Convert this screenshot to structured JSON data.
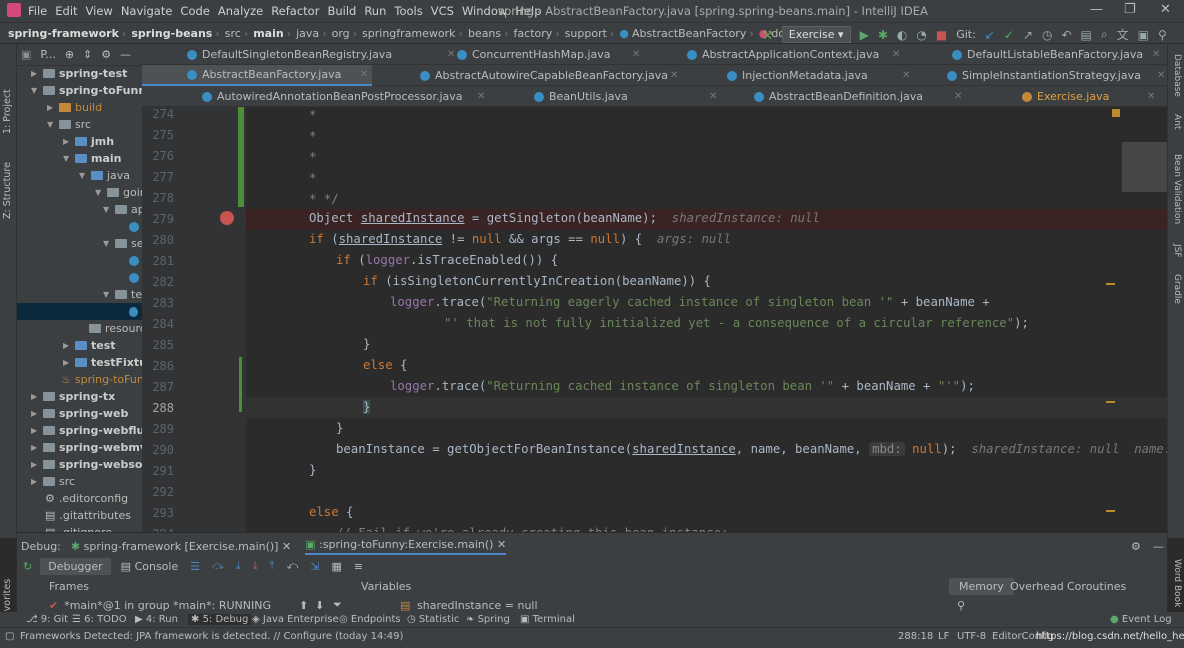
{
  "menu": [
    "File",
    "Edit",
    "View",
    "Navigate",
    "Code",
    "Analyze",
    "Refactor",
    "Build",
    "Run",
    "Tools",
    "VCS",
    "Window",
    "Help"
  ],
  "window_title": "spring - AbstractBeanFactory.java [spring.spring-beans.main] - IntelliJ IDEA",
  "breadcrumbs": [
    "spring-framework",
    "spring-beans",
    "src",
    "main",
    "java",
    "org",
    "springframework",
    "beans",
    "factory",
    "support",
    "AbstractBeanFactory",
    "doGetBean"
  ],
  "run_config": "Exercise",
  "git_label": "Git:",
  "project_panel": {
    "label": "P...",
    "tool_label": "1: Project",
    "structure_label": "Z: Structure"
  },
  "tree": [
    {
      "label": "spring-test",
      "bold": true
    },
    {
      "label": "spring-toFunny",
      "bold": true
    },
    {
      "label": "build",
      "bold": false
    },
    {
      "label": "src",
      "bold": false
    },
    {
      "label": "jmh",
      "bold": true
    },
    {
      "label": "main",
      "bold": true
    },
    {
      "label": "java",
      "bold": false
    },
    {
      "label": "going",
      "bold": false
    },
    {
      "label": "ap",
      "bold": false
    },
    {
      "label": "se",
      "bold": false
    },
    {
      "label": "tes",
      "bold": false
    },
    {
      "label": "resource",
      "bold": false
    },
    {
      "label": "test",
      "bold": true
    },
    {
      "label": "testFixtures",
      "bold": true
    },
    {
      "label": "spring-toFunny",
      "bold": false
    },
    {
      "label": "spring-tx",
      "bold": true
    },
    {
      "label": "spring-web",
      "bold": true
    },
    {
      "label": "spring-webflux",
      "bold": true
    },
    {
      "label": "spring-webmvc",
      "bold": true
    },
    {
      "label": "spring-websocke",
      "bold": true
    },
    {
      "label": "src",
      "bold": false
    },
    {
      "label": ".editorconfig",
      "bold": false
    },
    {
      "label": ".gitattributes",
      "bold": false
    },
    {
      "label": ".gitignore",
      "bold": false
    }
  ],
  "tabs_row1": [
    "DefaultSingletonBeanRegistry.java",
    "ConcurrentHashMap.java",
    "AbstractApplicationContext.java",
    "DefaultListableBeanFactory.java"
  ],
  "tabs_row2": [
    "AbstractBeanFactory.java",
    "AbstractAutowireCapableBeanFactory.java",
    "InjectionMetadata.java",
    "SimpleInstantiationStrategy.java"
  ],
  "tabs_row3": [
    "AutowiredAnnotationBeanPostProcessor.java",
    "BeanUtils.java",
    "AbstractBeanDefinition.java",
    "Exercise.java"
  ],
  "line_numbers": [
    "274",
    "275",
    "276",
    "277",
    "278",
    "279",
    "280",
    "281",
    "282",
    "283",
    "284",
    "285",
    "286",
    "287",
    "288",
    "289",
    "290",
    "291",
    "292",
    "293",
    "294"
  ],
  "code": {
    "l274": "*",
    "l275": "*",
    "l276": "*",
    "l277": "*",
    "l278": "* */",
    "l279_a": "Object ",
    "l279_b": "sharedInstance",
    "l279_c": " = getSingleton(beanName);",
    "l279_hint": "sharedInstance: null",
    "l280_a": "if",
    "l280_b": " (",
    "l280_c": "sharedInstance",
    "l280_d": " != ",
    "l280_e": "null",
    "l280_f": " && args == ",
    "l280_g": "null",
    "l280_h": ") {",
    "l280_hint": "args: null",
    "l281_a": "if",
    "l281_b": " (",
    "l281_c": "logger",
    "l281_d": ".isTraceEnabled()) {",
    "l282_a": "if",
    "l282_b": " (isSingletonCurrentlyInCreation(beanName)) {",
    "l283_a": "logger",
    "l283_b": ".trace(",
    "l283_c": "\"Returning eagerly cached instance of singleton bean '\"",
    "l283_d": " + beanName +",
    "l284_a": "\"' that is not fully initialized yet - a consequence of a circular reference\"",
    "l284_b": ");",
    "l285": "}",
    "l286_a": "else",
    "l286_b": " {",
    "l287_a": "logger",
    "l287_b": ".trace(",
    "l287_c": "\"Returning cached instance of singleton bean '\"",
    "l287_d": " + beanName + ",
    "l287_e": "\"'\"",
    "l287_f": ");",
    "l288": "}",
    "l289": "}",
    "l290_a": "beanInstance = getObjectForBeanInstance(",
    "l290_b": "sharedInstance",
    "l290_c": ", name, beanName, ",
    "l290_d": "mbd:",
    "l290_e": " null",
    "l290_f": ");",
    "l290_hint": "sharedInstance: null  name: \"",
    "l291": "}",
    "l293_a": "else",
    "l293_b": " {",
    "l294": "// Fail if we're already creating this bean instance:"
  },
  "debug": {
    "label": "Debug:",
    "tab1": "spring-framework [Exercise.main()]",
    "tab2": ":spring-toFunny:Exercise.main()",
    "debugger": "Debugger",
    "console": "Console",
    "frames": "Frames",
    "variables": "Variables",
    "memory": "Memory",
    "overhead": "Overhead",
    "coroutines": "Coroutines",
    "thread": "*main*@1 in group *main*: RUNNING",
    "var": "sharedInstance = null"
  },
  "bottom_tools": [
    "9: Git",
    "6: TODO",
    "4: Run",
    "5: Debug",
    "Java Enterprise",
    "Endpoints",
    "Statistic",
    "Spring",
    "Terminal"
  ],
  "event_log": "Event Log",
  "favorites_label": "2: Favorites",
  "right_tools": [
    "Database",
    "Ant",
    "Bean Validation",
    "JSF",
    "Gradle",
    "Word Book"
  ],
  "status": {
    "message": "Frameworks Detected: JPA framework is detected. // Configure (today 14:49)",
    "position": "288:18",
    "line_sep": "LF",
    "encoding": "UTF-8",
    "editorconfig": "EditorConfig",
    "url": "https://blog.csdn.net/hello_he"
  }
}
